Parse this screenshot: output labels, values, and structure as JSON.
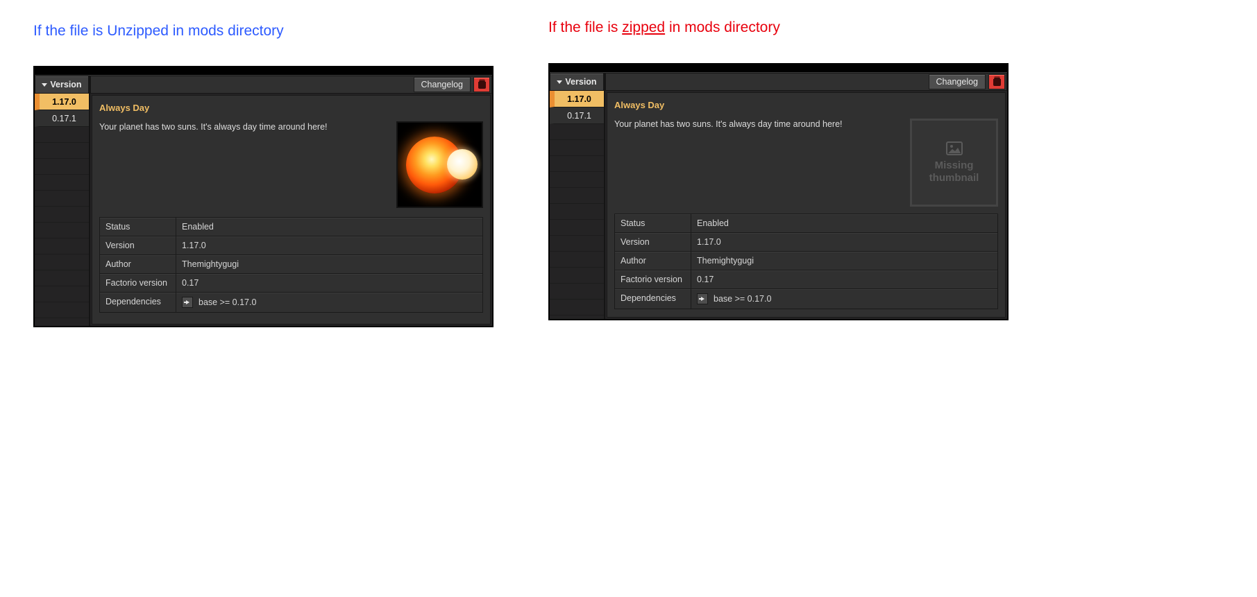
{
  "captions": {
    "unzipped_prefix": "If the file is Unzipped in mods directory",
    "zipped_prefix": "If the file is ",
    "zipped_word": "zipped",
    "zipped_suffix": " in mods directory"
  },
  "sidebar": {
    "header": "Version",
    "items": [
      "1.17.0",
      "0.17.1"
    ],
    "selected": "1.17.0"
  },
  "toolbar": {
    "changelog": "Changelog"
  },
  "mod": {
    "title": "Always Day",
    "description": "Your planet has two suns. It's always day time around here!"
  },
  "details": {
    "rows": [
      {
        "k": "Status",
        "v": "Enabled"
      },
      {
        "k": "Version",
        "v": "1.17.0"
      },
      {
        "k": "Author",
        "v": "Themightygugi"
      },
      {
        "k": "Factorio version",
        "v": "0.17"
      }
    ],
    "deps_label": "Dependencies",
    "deps_value": "base >= 0.17.0"
  },
  "missing_thumb": {
    "line1": "Missing",
    "line2": "thumbnail"
  }
}
